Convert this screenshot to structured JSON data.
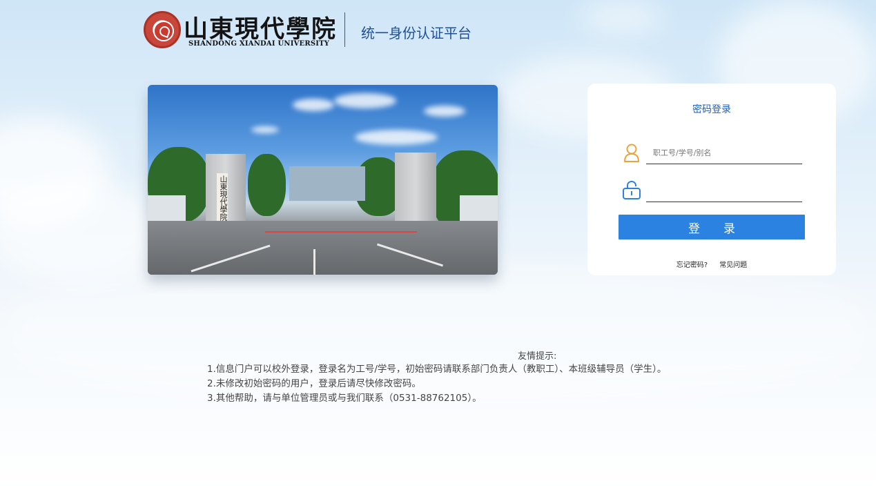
{
  "header": {
    "brand_cn": "山東現代學院",
    "brand_en": "SHANDONG XIANDAI UNIVERSITY",
    "platform_title": "统一身份认证平台"
  },
  "photo": {
    "pillar_text": "山東現代學院"
  },
  "login": {
    "title": "密码登录",
    "username_placeholder": "职工号/学号/别名",
    "username_value": "",
    "password_value": "",
    "button_label": "登录",
    "forgot_link": "忘记密码?",
    "faq_link": "常见问题"
  },
  "tips": {
    "title": "友情提示:",
    "lines": [
      "1.信息门户可以校外登录，登录名为工号/学号，初始密码请联系部门负责人（教职工）、本班级辅导员（学生）。",
      "2.未修改初始密码的用户，登录后请尽快修改密码。",
      "3.其他帮助，请与单位管理员或与我们联系（0531-88762105）。"
    ]
  },
  "colors": {
    "accent": "#2b82e0",
    "title_blue": "#1d5fc2",
    "icon_orange": "#f0a23a",
    "icon_blue": "#2b82e0"
  },
  "icons": {
    "user": "user-icon",
    "lock": "lock-icon"
  }
}
